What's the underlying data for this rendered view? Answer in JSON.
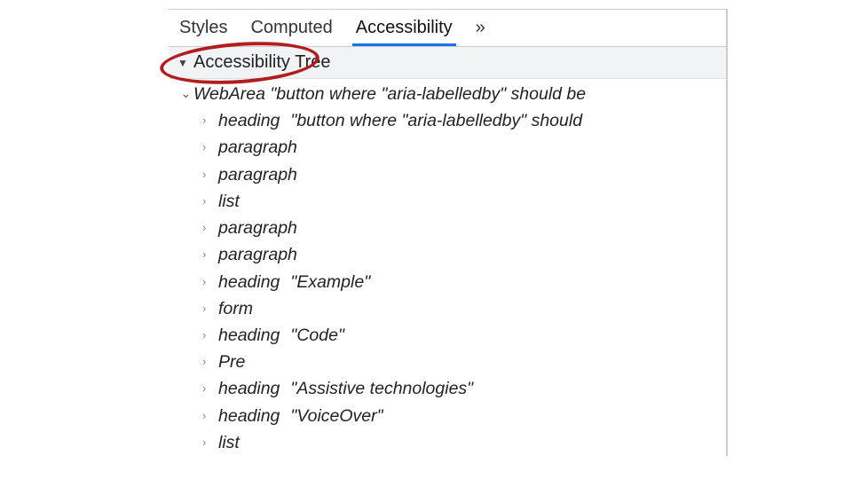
{
  "tabs": {
    "styles": "Styles",
    "computed": "Computed",
    "accessibility": "Accessibility",
    "more": "»"
  },
  "section": {
    "title": "Accessibility Tree",
    "disclosure_glyph": "▼"
  },
  "tree": {
    "root": {
      "chevron": "⌄",
      "role": "WebArea",
      "name": "\"button where \"aria-labelledby\" should be"
    },
    "children": [
      {
        "chevron": "›",
        "role": "heading",
        "name": "\"button where \"aria-labelledby\" should"
      },
      {
        "chevron": "›",
        "role": "paragraph",
        "name": ""
      },
      {
        "chevron": "›",
        "role": "paragraph",
        "name": ""
      },
      {
        "chevron": "›",
        "role": "list",
        "name": ""
      },
      {
        "chevron": "›",
        "role": "paragraph",
        "name": ""
      },
      {
        "chevron": "›",
        "role": "paragraph",
        "name": ""
      },
      {
        "chevron": "›",
        "role": "heading",
        "name": "\"Example\""
      },
      {
        "chevron": "›",
        "role": "form",
        "name": ""
      },
      {
        "chevron": "›",
        "role": "heading",
        "name": "\"Code\""
      },
      {
        "chevron": "›",
        "role": "Pre",
        "name": ""
      },
      {
        "chevron": "›",
        "role": "heading",
        "name": "\"Assistive technologies\""
      },
      {
        "chevron": "›",
        "role": "heading",
        "name": "\"VoiceOver\""
      },
      {
        "chevron": "›",
        "role": "list",
        "name": ""
      }
    ]
  }
}
